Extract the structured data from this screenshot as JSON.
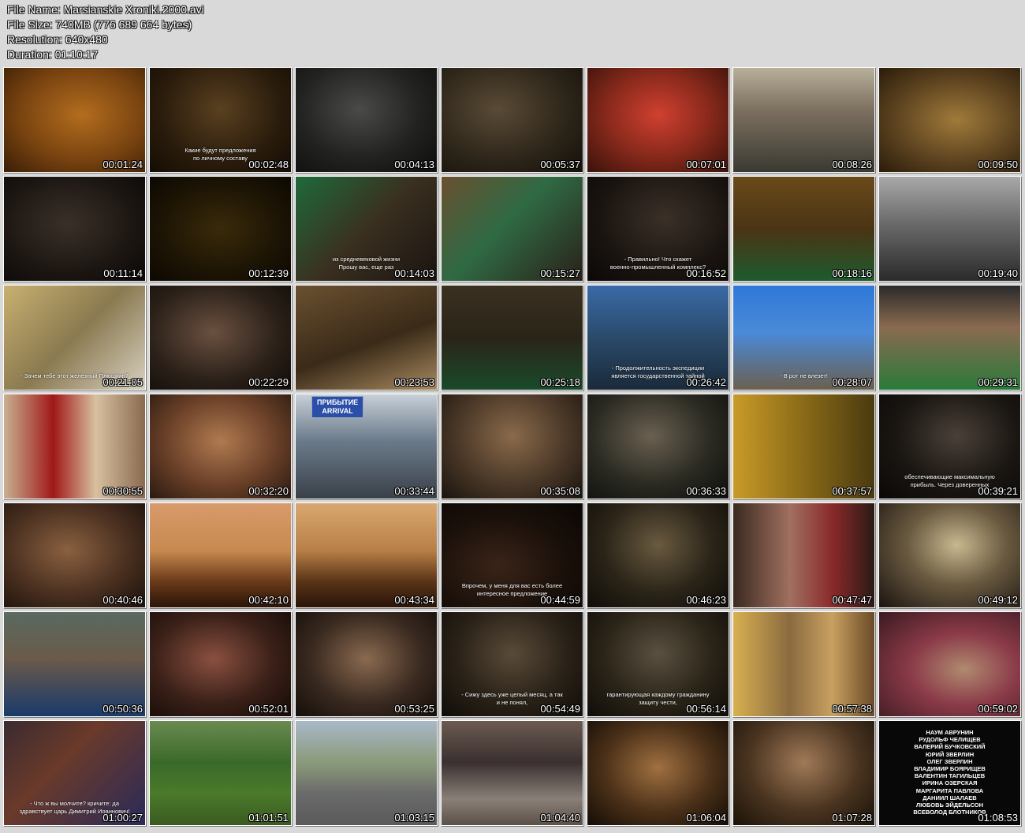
{
  "info": {
    "file_name": "File Name: Marsianskie Xroniki.2000.avi",
    "file_size": "File Size: 740MB (776 689 664 bytes)",
    "resolution": "Resolution: 640x480",
    "duration": "Duration: 01:10:17"
  },
  "thumbs": [
    {
      "time": "00:01:24",
      "bg": "radial-gradient(ellipse at 55% 45%, #b36d1e 0%, #7a4410 55%, #3a1e06 100%)"
    },
    {
      "time": "00:02:48",
      "bg": "radial-gradient(ellipse at 50% 40%, #5a4020 0%, #2a1c0c 60%, #140c04 100%)",
      "subtitle": "Какие будут предложения\nпо личному составу"
    },
    {
      "time": "00:04:13",
      "bg": "radial-gradient(ellipse at 45% 40%, #4a4a48 0%, #222220 55%, #0d0d0c 100%)"
    },
    {
      "time": "00:05:37",
      "bg": "radial-gradient(ellipse at 40% 40%, #5a4a36 0%, #2b2418 60%, #14100a 100%)"
    },
    {
      "time": "00:07:01",
      "bg": "radial-gradient(ellipse at 50% 45%, #d04030 0%, #8a2a1c 50%, #3a120a 100%)"
    },
    {
      "time": "00:08:26",
      "bg": "linear-gradient(180deg, #b8b09a 0%, #7d7060 40%, #3a3a32 100%)"
    },
    {
      "time": "00:09:50",
      "bg": "radial-gradient(ellipse at 55% 50%, #a07a3a 0%, #5e4420 55%, #2a1c0a 100%)"
    },
    {
      "time": "00:11:14",
      "bg": "radial-gradient(ellipse at 45% 45%, #3a3028 0%, #1c1612 60%, #0a0806 100%)"
    },
    {
      "time": "00:12:39",
      "bg": "radial-gradient(ellipse at 50% 50%, #3a2a0a 0%, #1c1404 60%, #0c0802 100%)"
    },
    {
      "time": "00:14:03",
      "bg": "linear-gradient(135deg, #1e6a3a 0%, #3a3020 50%, #1a1410 100%)",
      "subtitle": "из средневековой жизни\nПрошу вас, еще раз"
    },
    {
      "time": "00:15:27",
      "bg": "linear-gradient(135deg, #6a5030 0%, #2f6a44 45%, #2a2018 100%)"
    },
    {
      "time": "00:16:52",
      "bg": "radial-gradient(ellipse at 55% 40%, #3a3028 0%, #1a1410 60%, #0a0806 100%)",
      "subtitle": "- Правильно! Что скажет\nвоенно-промышленный комплекс?"
    },
    {
      "time": "00:18:16",
      "bg": "linear-gradient(180deg, #6a4a1a 0%, #4a3414 50%, #1e5a2e 100%)"
    },
    {
      "time": "00:19:40",
      "bg": "linear-gradient(180deg, #a8a8a8 0%, #6a6a6a 45%, #2a2a2a 100%)"
    },
    {
      "time": "00:21:05",
      "bg": "linear-gradient(135deg, #c8b070 0%, #8a7a50 50%, #d8d0c0 100%)",
      "subtitle": "- Зачем тебе этот железный Плюшкин?"
    },
    {
      "time": "00:22:29",
      "bg": "radial-gradient(ellipse at 45% 45%, #6a5040 0%, #2a2018 60%, #100c08 100%)"
    },
    {
      "time": "00:23:53",
      "bg": "linear-gradient(160deg, #6a5030 0%, #3a2a18 55%, #a88a60 100%)"
    },
    {
      "time": "00:25:18",
      "bg": "linear-gradient(180deg, #3a3020 0%, #2a2418 50%, #1a4a2a 100%)"
    },
    {
      "time": "00:26:42",
      "bg": "linear-gradient(180deg, #3a6aa8 0%, #2a4a6a 50%, #1a2a3a 100%)",
      "subtitle": "- Продолжительность экспедиции\nявляется государственной тайной"
    },
    {
      "time": "00:28:07",
      "bg": "linear-gradient(180deg, #2f78d8 0%, #4a8ad8 45%, #6a6050 100%)",
      "subtitle": "- В рот не влезет!"
    },
    {
      "time": "00:29:31",
      "bg": "linear-gradient(180deg, #2a2a2a 0%, #8a6a50 40%, #2a7a3a 100%)"
    },
    {
      "time": "00:30:55",
      "bg": "linear-gradient(90deg, #c8b090 0%, #a01818 35%, #d8c0a0 65%, #8a6a50 100%)"
    },
    {
      "time": "00:32:20",
      "bg": "radial-gradient(ellipse at 50% 45%, #b07a50 0%, #6a4028 55%, #2a1a10 100%)"
    },
    {
      "time": "00:33:44",
      "bg": "linear-gradient(180deg, #c8d0d8 0%, #6a7a8a 45%, #3a4048 100%)",
      "sign": "ПРИБЫТИЕ\nARRIVAL"
    },
    {
      "time": "00:35:08",
      "bg": "radial-gradient(ellipse at 50% 40%, #8a6a4a 0%, #4a3828 55%, #1a140e 100%)"
    },
    {
      "time": "00:36:33",
      "bg": "radial-gradient(ellipse at 45% 40%, #6a6050 0%, #2a2a22 55%, #0e0e0c 100%)"
    },
    {
      "time": "00:37:57",
      "bg": "linear-gradient(90deg, #c89a28 0%, #8a6a18 50%, #4a3a10 100%)"
    },
    {
      "time": "00:39:21",
      "bg": "radial-gradient(ellipse at 55% 40%, #4a4038 0%, #1a1612 55%, #0a0806 100%)",
      "subtitle": "обеспечивающие максимальную\nприбыль. Через доверенных"
    },
    {
      "time": "00:40:46",
      "bg": "radial-gradient(ellipse at 45% 45%, #8a6040 0%, #4a3020 55%, #1a100a 100%)"
    },
    {
      "time": "00:42:10",
      "bg": "linear-gradient(180deg, #d89a6a 0%, #c88a50 45%, #6a3a18 75%, #2a1408 100%)"
    },
    {
      "time": "00:43:34",
      "bg": "linear-gradient(180deg, #d8a870 0%, #b88048 45%, #5a3418 75%, #2a1408 100%)"
    },
    {
      "time": "00:44:59",
      "bg": "radial-gradient(ellipse at 40% 60%, #3a2418 0%, #1a100a 55%, #0a0604 100%)",
      "subtitle": "Впрочем, у меня для вас есть более\nинтересное предложение"
    },
    {
      "time": "00:46:23",
      "bg": "radial-gradient(ellipse at 50% 40%, #6a5a40 0%, #2a2418 55%, #100c08 100%)"
    },
    {
      "time": "00:47:47",
      "bg": "linear-gradient(90deg, #3a2a20 0%, #a07060 40%, #8a2a2a 70%, #2a1a14 100%)"
    },
    {
      "time": "00:49:12",
      "bg": "radial-gradient(ellipse at 55% 40%, #c8b890 0%, #6a5a40 45%, #1a1410 100%)"
    },
    {
      "time": "00:50:36",
      "bg": "linear-gradient(180deg, #5a6a60 0%, #6a5a4a 45%, #1a3a6a 100%)"
    },
    {
      "time": "00:52:01",
      "bg": "radial-gradient(ellipse at 45% 45%, #8a5040 0%, #3a2018 55%, #140a06 100%)"
    },
    {
      "time": "00:53:25",
      "bg": "radial-gradient(ellipse at 50% 45%, #8a6a50 0%, #3a2a20 55%, #140e0a 100%)"
    },
    {
      "time": "00:54:49",
      "bg": "radial-gradient(ellipse at 50% 40%, #5a4a38 0%, #2a2218 55%, #100c08 100%)",
      "subtitle": "- Сижу здесь уже целый месяц, а так\nи не понял,"
    },
    {
      "time": "00:56:14",
      "bg": "radial-gradient(ellipse at 50% 40%, #5a5040 0%, #2a2418 55%, #100c08 100%)",
      "subtitle": "гарантирующая каждому гражданину\nзащиту чести,"
    },
    {
      "time": "00:57:38",
      "bg": "linear-gradient(90deg, #d8b050 0%, #8a6a40 40%, #c8a060 70%, #6a4a28 100%)"
    },
    {
      "time": "00:59:02",
      "bg": "radial-gradient(ellipse at 60% 55%, #b08a70 0%, #8a3a48 45%, #3a1a20 100%)"
    },
    {
      "time": "01:00:27",
      "bg": "linear-gradient(135deg, #3a2a30 0%, #6a3a2a 40%, #2a2a5a 100%)",
      "subtitle": "- Что ж вы молчите? кричите: да\nздравствует царь Димитрий Иоаннович!"
    },
    {
      "time": "01:01:51",
      "bg": "linear-gradient(180deg, #6a8a50 0%, #3a6a2a 40%, #4a7a2a 70%, #3a5a20 100%)"
    },
    {
      "time": "01:03:15",
      "bg": "linear-gradient(180deg, #a8b8c8 0%, #8a9a7a 40%, #6a6a6a 70%, #5a5a5a 100%)"
    },
    {
      "time": "01:04:40",
      "bg": "linear-gradient(180deg, #6a5a50 0%, #3a3030 40%, #8a8078 75%, #5a5048 100%)"
    },
    {
      "time": "01:06:04",
      "bg": "radial-gradient(ellipse at 50% 45%, #a07040 0%, #4a3018 55%, #140c06 100%)"
    },
    {
      "time": "01:07:28",
      "bg": "radial-gradient(ellipse at 50% 40%, #a07a58 0%, #4a3420 55%, #1a1208 100%)"
    },
    {
      "time": "01:08:53",
      "bg": "#080808",
      "credits": "НАУМ АВРУНИН\nРУДОЛЬФ ЧЕЛИЩЕВ\nВАЛЕРИЙ БУЧКОВСКИЙ\nЮРИЙ ЗВЕРЛИН\nОЛЕГ ЗВЕРЛИН\nВЛАДИМИР БОЯРИЩЕВ\nВАЛЕНТИН ТАГИЛЬЦЕВ\nИРИНА ОЗЕРСКАЯ\nМАРГАРИТА ПАВЛОВА\nДАНИИЛ ШАЛАЕВ\nЛЮБОВЬ ЭЙДЕЛЬСОН\nВСЕВОЛОД БЛОТНИКОВ"
    }
  ]
}
